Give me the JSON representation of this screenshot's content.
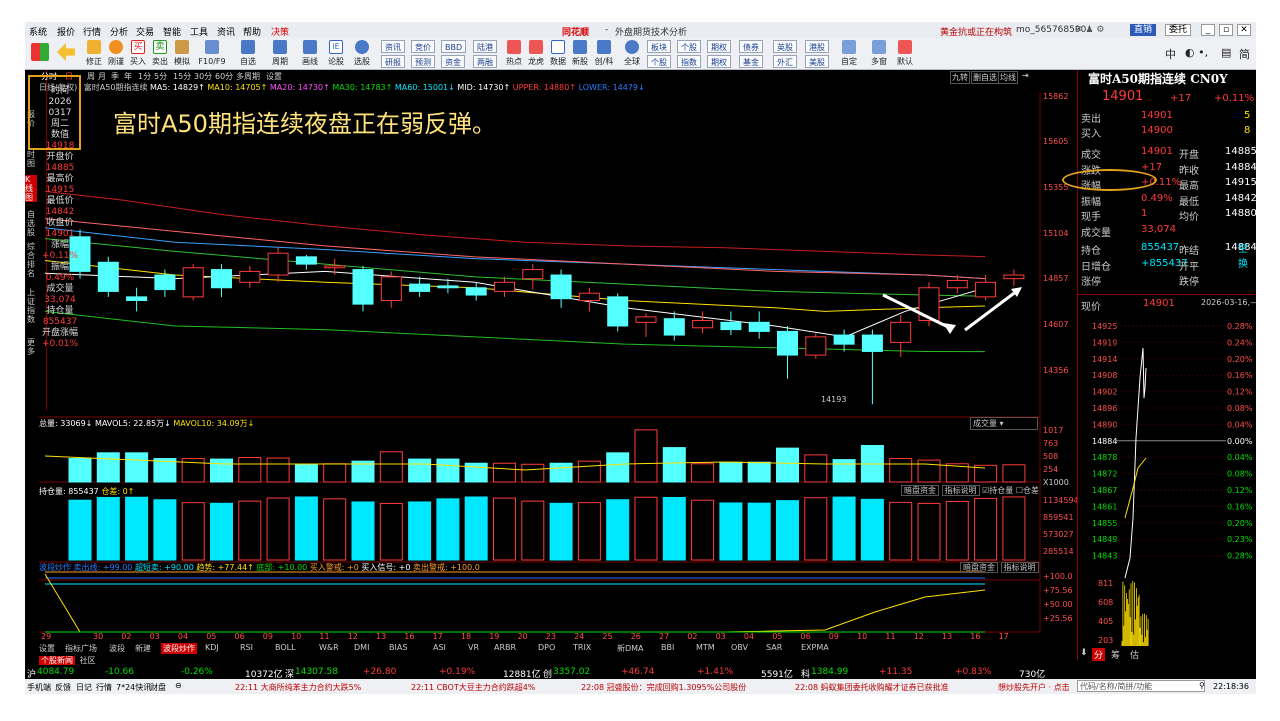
{
  "window": {
    "title": "外盘期货技术分析",
    "brand": "同花顺",
    "notice": "黄金抗或正在构筑",
    "user": "mo_565768590",
    "button_direct": "直销",
    "button_choose": "委托"
  },
  "menu": [
    "系统",
    "报价",
    "行情",
    "分析",
    "交易",
    "智能",
    "工具",
    "资讯",
    "帮助",
    "决策"
  ],
  "toolbar": {
    "items": [
      "修正",
      "刚谨",
      "买入",
      "卖出",
      "模拟",
      "F10/F9",
      "自选",
      "周期",
      "画线",
      "论股",
      "选股",
      "研报",
      "预测",
      "资金",
      "两融",
      "热点",
      "龙虎",
      "数据",
      "新股",
      "创/科",
      "全球"
    ],
    "small_buttons": [
      "资讯",
      "竞价",
      "BBD",
      "陆港",
      "个股",
      "指数",
      "期权",
      "债券",
      "英股",
      "港股",
      "研报",
      "预测",
      "资金",
      "两融",
      "板块",
      "基金",
      "外汇",
      "美股"
    ],
    "right_labels": [
      "自定",
      "多窗",
      "默认"
    ],
    "input_icons": [
      "中",
      "简"
    ]
  },
  "periods": {
    "items": [
      "分时",
      "日",
      "周",
      "月",
      "季",
      "年",
      "1分",
      "5分",
      "15分",
      "30分",
      "60分",
      "多周期",
      "设置"
    ],
    "right": [
      "九转",
      "删自选",
      "均线"
    ]
  },
  "ma_legend": {
    "name": "富时A50期指连续",
    "ma5": "MA5: 14829↑",
    "ma10": "MA10: 14705↑",
    "ma20": "MA20: 14730↑",
    "ma30": "MA30: 14783↑",
    "ma60": "MA60: 15001↓",
    "mid": "MID: 14730↑",
    "upper": "UPPER: 14880↑",
    "lower": "LOWER: 14479↓"
  },
  "sidebar": {
    "tabs": [
      "报价",
      "时图",
      "K线图",
      "自选股",
      "综合排名",
      "上证指数",
      "更多"
    ],
    "kline_label": "日线(复权)"
  },
  "data_panel": {
    "rows": [
      {
        "l": "时间",
        "v": "2026"
      },
      {
        "l": "",
        "v": "0317"
      },
      {
        "l": "",
        "v": "周二"
      },
      {
        "l": "数值",
        "v": "14918"
      },
      {
        "l": "开盘价",
        "v": "14885"
      },
      {
        "l": "最高价",
        "v": "14915"
      },
      {
        "l": "最低价",
        "v": "14842"
      },
      {
        "l": "收盘价",
        "v": "14901"
      },
      {
        "l": "涨幅",
        "v": "+0.11%"
      },
      {
        "l": "振幅",
        "v": "0.49%"
      },
      {
        "l": "成交量",
        "v": "33,074"
      },
      {
        "l": "持仓量",
        "v": "855437"
      },
      {
        "l": "开盘涨幅",
        "v": "+0.01%"
      }
    ]
  },
  "headline": "富时A50期指连续夜盘正在弱反弹。",
  "price_axis": [
    "15862",
    "15605",
    "15355",
    "15104",
    "14857",
    "14607",
    "14356"
  ],
  "low_label": "14193",
  "volume_legend": {
    "total": "总量: 33069↓",
    "mavol5": "MAVOL5: 22.85万↓",
    "mavol10": "MAVOL10: 34.09万↓",
    "selector": "成交量"
  },
  "volume_axis": [
    "1017",
    "763",
    "508",
    "254",
    "X1000"
  ],
  "oi_legend": {
    "label": "持仓量: 855437",
    "diff": "仓差: 0↑",
    "btn1": "暗盘资金",
    "btn2": "指标说明",
    "chk1": "持仓量",
    "chk2": "仓差"
  },
  "oi_axis": [
    "1134594",
    "859541",
    "573027",
    "285514"
  ],
  "ind_legend": {
    "a": "波段炒作",
    "b": "卖出线: +99.00",
    "c": "超短卖: +90.00",
    "d": "趋势: +77.44↑",
    "e": "底部: +10.00",
    "f": "买入警戒: +0",
    "g": "买入信号: +0",
    "h": "卖出警戒: +100.0",
    "btn1": "暗盘资金",
    "btn2": "指标说明"
  },
  "ind_axis": [
    "+100.0",
    "+75.56",
    "+50.00",
    "+25.56"
  ],
  "dates": [
    "29",
    "30",
    "02",
    "03",
    "04",
    "05",
    "06",
    "09",
    "10",
    "11",
    "12",
    "13",
    "16",
    "17",
    "18",
    "19",
    "20",
    "23",
    "24",
    "25",
    "26",
    "27",
    "02",
    "03",
    "04",
    "05",
    "06",
    "09",
    "10",
    "11",
    "12",
    "13",
    "16",
    "17"
  ],
  "indicator_tabs": [
    "设置",
    "指标广场",
    "波段",
    "新建",
    "波段炒作",
    "KDJ",
    "RSI",
    "BOLL",
    "W&R",
    "DMI",
    "BIAS",
    "ASI",
    "VR",
    "ARBR",
    "DPO",
    "TRIX",
    "新DMA",
    "BBI",
    "MTM",
    "OBV",
    "SAR",
    "EXPMA"
  ],
  "news_tabs": [
    "个股新闻",
    "社区"
  ],
  "quote": {
    "title": "富时A50期指连续 CN0Y",
    "price": "14901",
    "change": "+17",
    "pct": "+0.11%",
    "sell_label": "卖出",
    "sell_price": "14901",
    "sell_vol": "5",
    "buy_label": "买入",
    "buy_price": "14900",
    "buy_vol": "8",
    "rows": [
      {
        "l1": "成交",
        "v1": "14901",
        "l2": "开盘",
        "v2": "14885"
      },
      {
        "l1": "涨跌",
        "v1": "+17",
        "l2": "昨收",
        "v2": "14884"
      },
      {
        "l1": "涨幅",
        "v1": "+0.11%",
        "l2": "最高",
        "v2": "14915"
      },
      {
        "l1": "振幅",
        "v1": "0.49%",
        "l2": "最低",
        "v2": "14842"
      },
      {
        "l1": "现手",
        "v1": "1",
        "l2": "均价",
        "v2": "14880"
      },
      {
        "l1": "成交量",
        "v1": "33,074",
        "l2": "",
        "v2": ""
      }
    ],
    "rows2": [
      {
        "l1": "持仓",
        "v1": "855437",
        "l2": "昨结",
        "v2": "14884"
      },
      {
        "l1": "日增仓",
        "v1": "+855437",
        "l2": "开平",
        "v2": "空换"
      },
      {
        "l1": "涨停",
        "v1": "",
        "l2": "跌停",
        "v2": ""
      }
    ],
    "current_label": "现价",
    "current_price": "14901",
    "current_date": "2026-03-16,—"
  },
  "intraday_left": [
    "14925",
    "14919",
    "14914",
    "14908",
    "14902",
    "14896",
    "14890",
    "14884",
    "14878",
    "14872",
    "14867",
    "14861",
    "14855",
    "14849",
    "14843"
  ],
  "intraday_right": [
    "0.28%",
    "0.24%",
    "0.20%",
    "0.16%",
    "0.12%",
    "0.08%",
    "0.04%",
    "0.00%",
    "0.04%",
    "0.08%",
    "0.12%",
    "0.16%",
    "0.20%",
    "0.23%",
    "0.28%"
  ],
  "intraday_vol": [
    "811",
    "608",
    "405",
    "203"
  ],
  "rp_tabs": [
    "分",
    "筹",
    "估"
  ],
  "market": [
    {
      "n": "沪",
      "p": "4084.79",
      "c": "-10.66",
      "pc": "-0.26%",
      "a": "10372亿"
    },
    {
      "n": "深",
      "p": "14307.58",
      "c": "+26.80",
      "pc": "+0.19%",
      "a": "12881亿"
    },
    {
      "n": "创",
      "p": "3357.02",
      "c": "+46.74",
      "pc": "+1.41%",
      "a": "5591亿"
    },
    {
      "n": "科",
      "p": "1384.99",
      "c": "+11.35",
      "pc": "+0.83%",
      "a": "730亿"
    }
  ],
  "status": {
    "left": [
      "手机端",
      "反馈",
      "日记",
      "行情",
      "7*24快讯",
      "财盘"
    ],
    "news": [
      "22:11 大商所纯苯主力合约大跌5%",
      "22:11 CBOT大豆主力合约跌超4%",
      "22:08 冠盛股份：完成回购1.3095%公司股份",
      "22:08 蚂蚁集团委托收购耀才证券已获批准"
    ],
    "right": "想炒股先开户 · 点击",
    "search": "代码/名称/简拼/功能",
    "time": "22:18:36"
  },
  "colors": {
    "up": "#ff3b3b",
    "down": "#54ffff",
    "bg": "#000000",
    "accent": "#e4a21a"
  }
}
